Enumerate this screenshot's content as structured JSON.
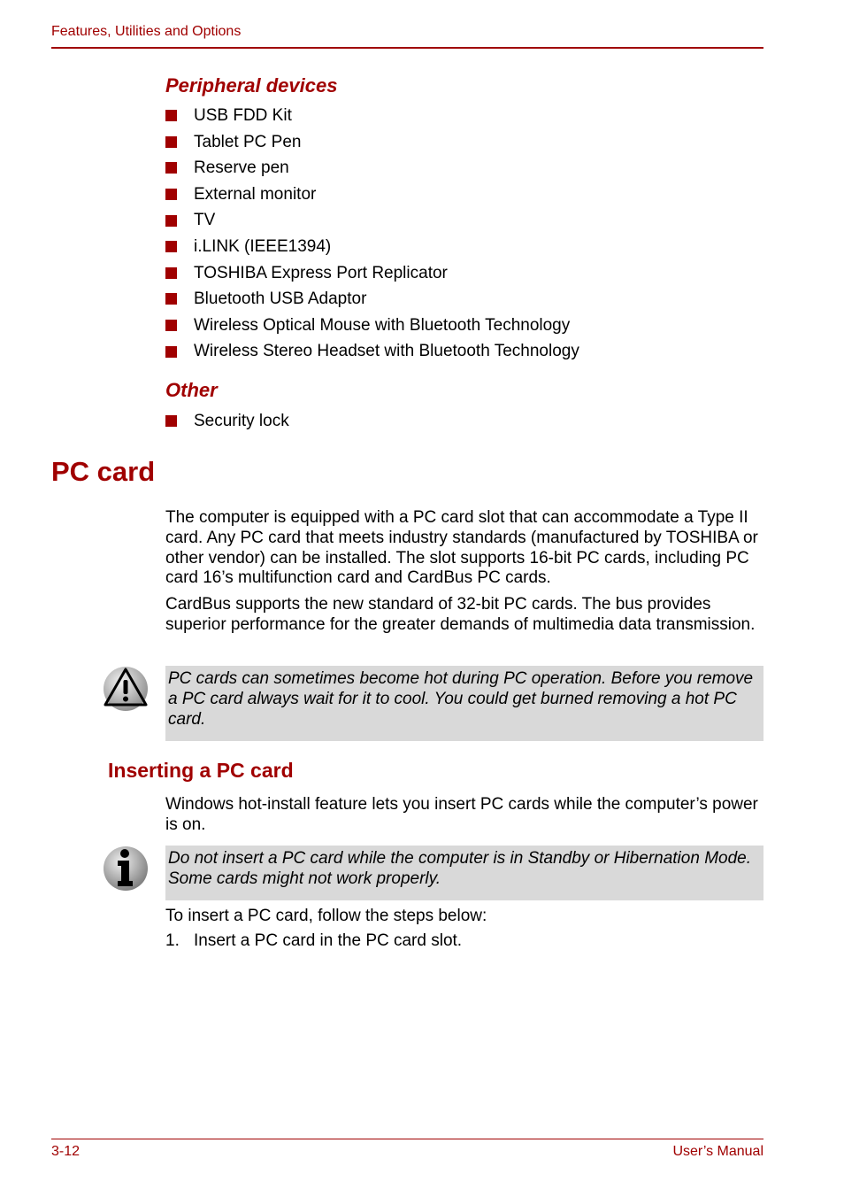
{
  "header": {
    "title": "Features, Utilities and Options"
  },
  "peripheral": {
    "heading": "Peripheral devices",
    "items": [
      "USB FDD Kit",
      "Tablet PC Pen",
      "Reserve pen",
      "External monitor",
      "TV",
      "i.LINK (IEEE1394)",
      "TOSHIBA Express Port Replicator",
      "Bluetooth USB Adaptor",
      "Wireless Optical Mouse with Bluetooth Technology",
      "Wireless Stereo Headset with Bluetooth Technology"
    ]
  },
  "other": {
    "heading": "Other",
    "items": [
      "Security lock"
    ]
  },
  "pc_card": {
    "heading": "PC card",
    "paragraphs": [
      "The computer is equipped with a PC card slot that can accommodate a Type II card. Any PC card that meets industry standards (manufactured by TOSHIBA or other vendor) can be installed. The slot supports 16-bit PC cards, including PC card 16’s multifunction card and CardBus PC cards.",
      "CardBus supports the new standard of 32-bit PC cards. The bus provides superior performance for the greater demands of multimedia data transmission."
    ],
    "caution_note": "PC cards can sometimes become hot during PC operation. Before you remove a PC card always wait for it to cool. You could get burned removing a hot PC card."
  },
  "inserting": {
    "heading": "Inserting a PC card",
    "intro": "Windows hot-install feature lets you insert PC cards while the computer’s power is on.",
    "info_note": "Do not insert a PC card while the computer is in Standby or Hibernation Mode. Some cards might not work properly.",
    "steps_intro": "To insert a PC card, follow the steps below:",
    "steps": [
      {
        "num": "1.",
        "text": "Insert a PC card in the PC card slot."
      }
    ]
  },
  "footer": {
    "page_number": "3-12",
    "manual_title": "User’s Manual"
  },
  "colors": {
    "accent": "#a00000",
    "note_bg": "#d9d9d9"
  }
}
